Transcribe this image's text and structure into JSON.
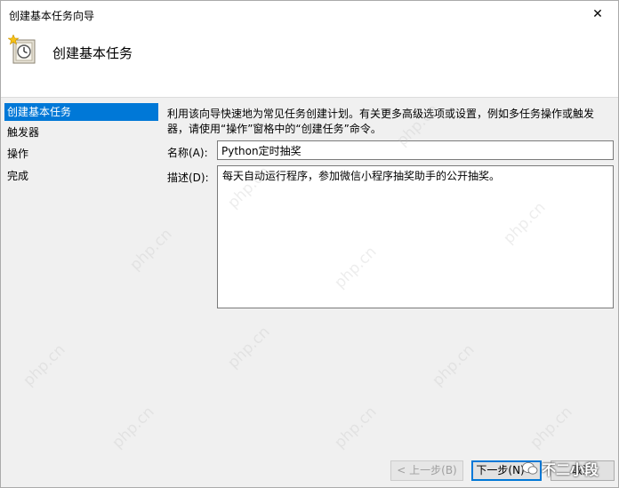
{
  "window": {
    "title": "创建基本任务向导",
    "close_glyph": "✕"
  },
  "header": {
    "title": "创建基本任务",
    "icon": "task-clock-icon"
  },
  "nav": {
    "items": [
      {
        "label": "创建基本任务",
        "selected": true
      },
      {
        "label": "触发器",
        "selected": false
      },
      {
        "label": "操作",
        "selected": false
      },
      {
        "label": "完成",
        "selected": false
      }
    ]
  },
  "form": {
    "instructions": "利用该向导快速地为常见任务创建计划。有关更多高级选项或设置，例如多任务操作或触发器，请使用“操作”窗格中的“创建任务”命令。",
    "name_label": "名称(A):",
    "name_value": "Python定时抽奖",
    "desc_label": "描述(D):",
    "desc_value": "每天自动运行程序，参加微信小程序抽奖助手的公开抽奖。"
  },
  "buttons": {
    "back": "< 上一步(B)",
    "next": "下一步(N) >",
    "cancel": "取消"
  },
  "watermark": {
    "text": "php.cn",
    "brand": "不二小段"
  },
  "colors": {
    "accent": "#0078d7",
    "panel": "#f0f0f0"
  }
}
